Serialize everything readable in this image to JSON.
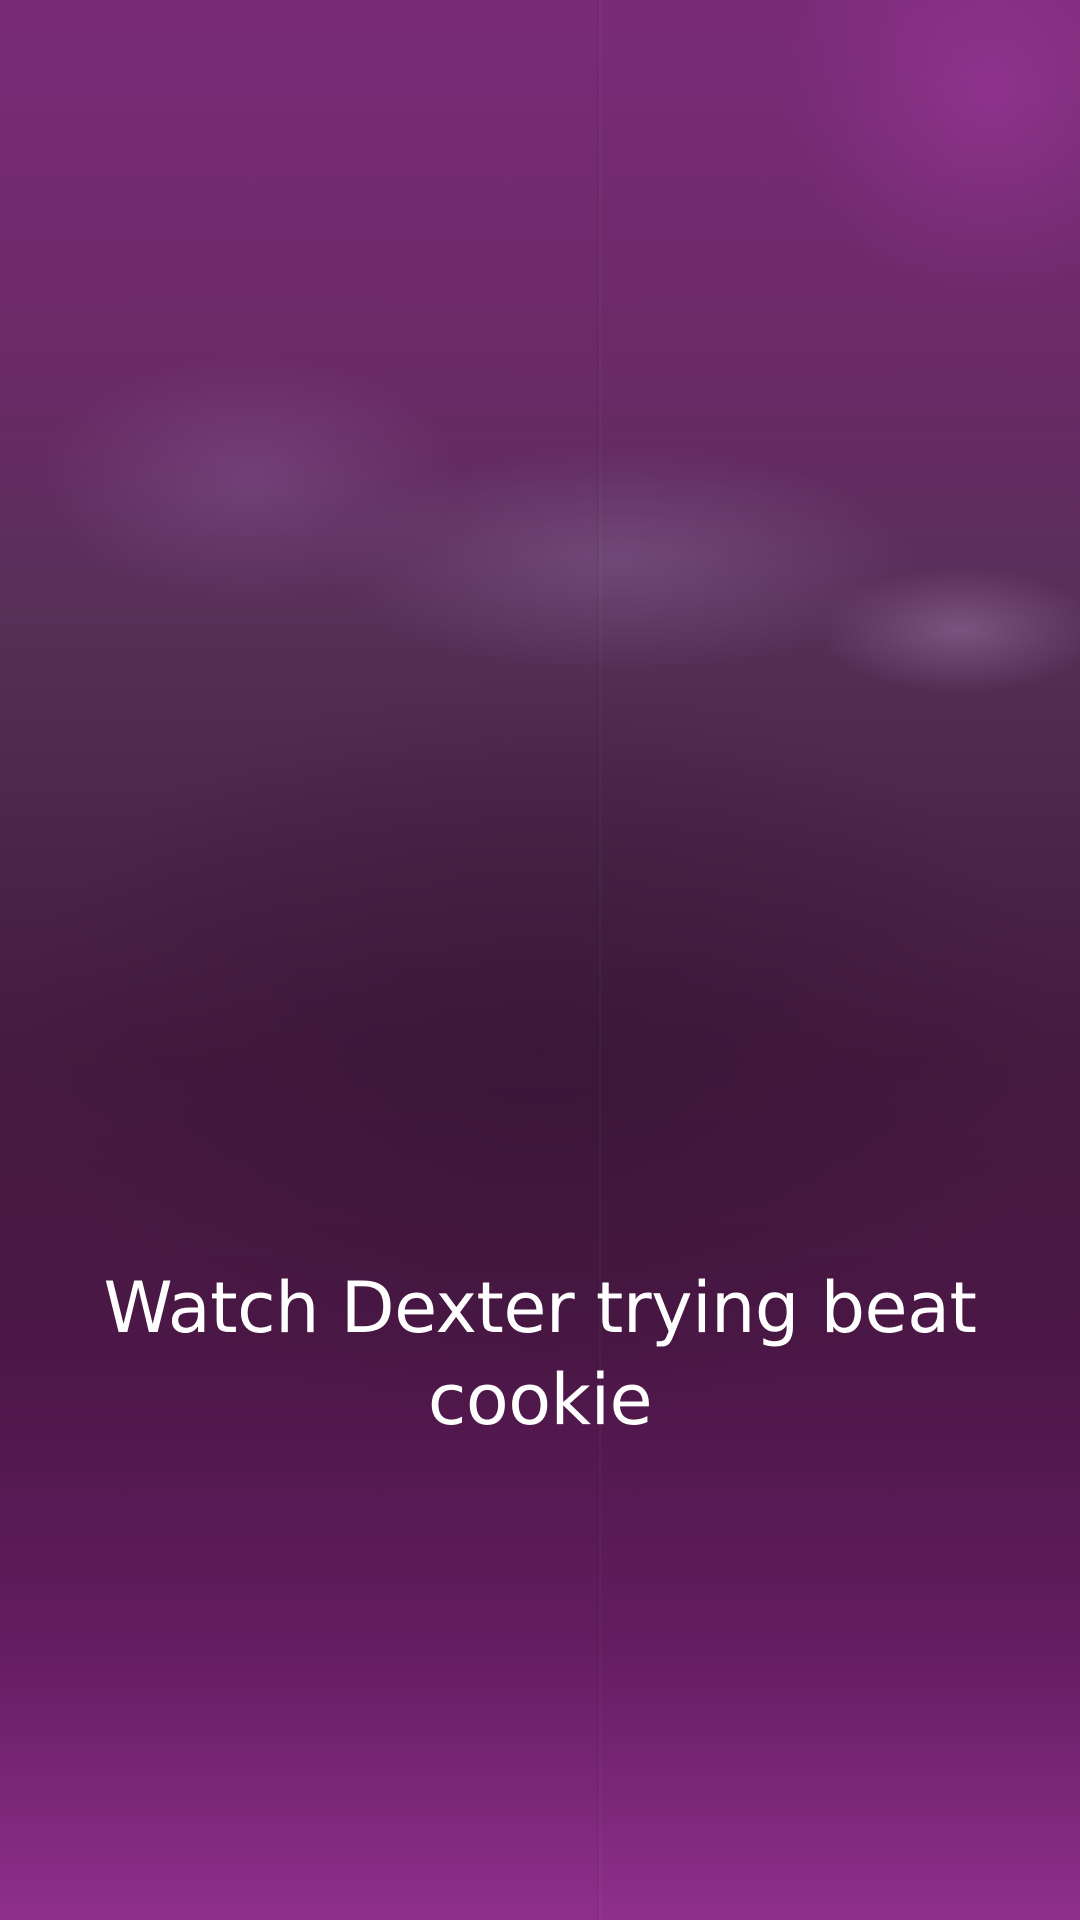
{
  "video": {
    "caption": "Watch Dexter trying beat cookie"
  },
  "colors": {
    "background_top": "#7a2b78",
    "background_middle": "#451a40",
    "background_bottom": "#8e2f8c",
    "caption_text": "#ffffff"
  }
}
